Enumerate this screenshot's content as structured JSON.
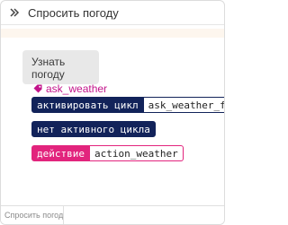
{
  "header": {
    "collapse_icon": "double-chevron-right-icon",
    "title": "Спросить погоду"
  },
  "intent": {
    "title": "Узнать погоду",
    "tag_icon": "tag-icon",
    "tag_name": "ask_weather"
  },
  "steps": [
    {
      "label": "активировать цикл",
      "value": "ask_weather_form",
      "color": "#12235a"
    },
    {
      "label": "нет активного цикла",
      "color": "#12235a"
    },
    {
      "label": "действие",
      "value": "action_weather",
      "color": "#e2247d"
    }
  ],
  "footer": {
    "tab_label": "Спросить погоду"
  },
  "colors": {
    "navy": "#12235a",
    "pink": "#e2247d",
    "intent_bg": "#e8e8e8",
    "strip_bg": "#fdf6ee"
  }
}
